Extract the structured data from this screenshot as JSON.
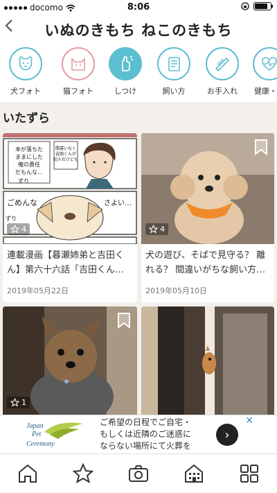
{
  "status_bar": {
    "carrier": "docomo",
    "time": "8:06"
  },
  "header": {
    "back_label": "<",
    "brand": "いぬのきもち ねこのきもち"
  },
  "categories": [
    {
      "label": "犬フォト",
      "icon": "dog-icon"
    },
    {
      "label": "猫フォト",
      "icon": "cat-icon"
    },
    {
      "label": "しつけ",
      "icon": "training-hand-icon"
    },
    {
      "label": "飼い方",
      "icon": "book-icon"
    },
    {
      "label": "お手入れ",
      "icon": "comb-icon"
    },
    {
      "label": "健康・病",
      "icon": "health-heart-icon"
    }
  ],
  "section": {
    "title": "いたずら"
  },
  "articles": [
    {
      "title_line1": "連載漫画【暮瀬姉弟と吉田く",
      "title_line2": "ん】第六十六話「吉田くん…",
      "date": "2019年05月22日",
      "likes": "4"
    },
    {
      "title_line1": "犬の遊び、そばで見守る？ 離",
      "title_line2": "れる？ 間違いがちな飼い方…",
      "date": "2019年05月10日",
      "likes": "4"
    },
    {
      "likes": "1"
    },
    {}
  ],
  "comic": {
    "bubble_main": "本が落ちたままにした俺の責任だもんな…",
    "bubble_small": "間違いなく吉田くんが犯人だけども",
    "sorry": "ごめんな",
    "sayo": "さよい…",
    "sfx1": "ずり",
    "sfx2": "ずり"
  },
  "ad": {
    "logo_line1": "Japan",
    "logo_line2": "Pet",
    "logo_line3": "Ceremony",
    "line1": "ご希望の日程でご自宅・",
    "line2": "もしくは近隣のご迷惑に",
    "line3": "ならない場所にて火葬を",
    "arrow": "›",
    "close": "✕"
  },
  "colors": {
    "accent": "#5bbfd0",
    "pink": "#e69aa0"
  }
}
